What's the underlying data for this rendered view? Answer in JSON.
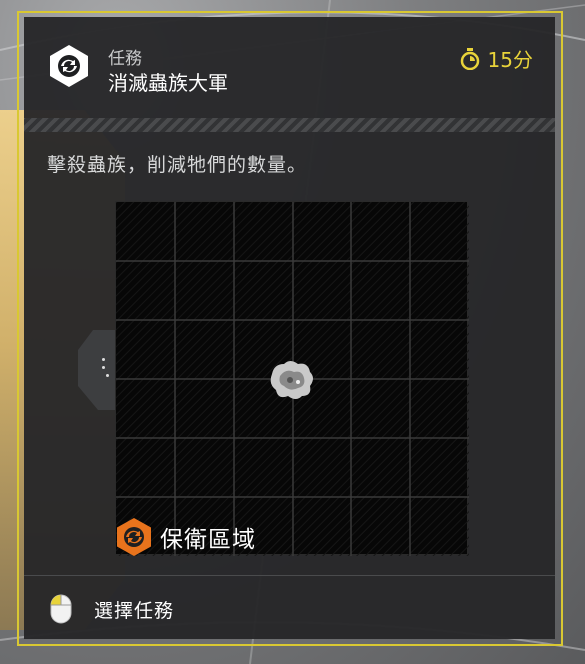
{
  "mission": {
    "kicker": "任務",
    "title": "消滅蟲族大軍",
    "icon": "mission-hex-icon",
    "timer_value": "15分",
    "timer_icon": "stopwatch-icon",
    "description": "擊殺蟲族，削減牠們的數量。"
  },
  "map": {
    "zone_label": "保衛區域",
    "zone_icon": "defend-zone-icon",
    "grid_cols": 6,
    "grid_rows": 6,
    "marker_icon": "bug-swarm-icon"
  },
  "footer": {
    "action_icon": "mouse-left-click-icon",
    "action_label": "選擇任務"
  },
  "colors": {
    "accent_yellow": "#e8d33a",
    "frame_yellow": "#d9c832",
    "icon_orange": "#e8731c",
    "panel_bg": "#262729"
  }
}
